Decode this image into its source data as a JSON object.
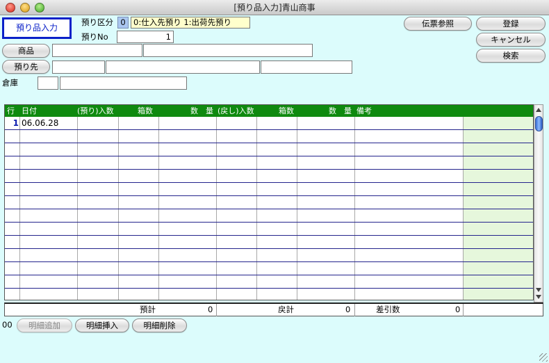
{
  "window": {
    "title": "[預り品入力]青山商事"
  },
  "mode_label": "預り品入力",
  "form": {
    "kubun_label": "預り区分",
    "kubun_code": "0",
    "kubun_desc": "0:仕入先預り 1:出荷先預り",
    "no_label": "預りNo",
    "no_value": "1",
    "product_button": "商品",
    "customer_button": "預り先",
    "warehouse_label": "倉庫"
  },
  "buttons": {
    "slip_ref": "伝票参照",
    "register": "登録",
    "cancel": "キャンセル",
    "search": "検索"
  },
  "table": {
    "headers": [
      "行",
      "日付",
      "(預り)入数",
      "箱数",
      "数　量",
      "(戻し)入数",
      "箱数",
      "数　量",
      "備考"
    ],
    "rows": [
      {
        "num": "1",
        "date": "06.06.28"
      },
      {
        "num": "",
        "date": ""
      },
      {
        "num": "",
        "date": ""
      },
      {
        "num": "",
        "date": ""
      },
      {
        "num": "",
        "date": ""
      },
      {
        "num": "",
        "date": ""
      },
      {
        "num": "",
        "date": ""
      },
      {
        "num": "",
        "date": ""
      },
      {
        "num": "",
        "date": ""
      },
      {
        "num": "",
        "date": ""
      },
      {
        "num": "",
        "date": ""
      },
      {
        "num": "",
        "date": ""
      },
      {
        "num": "",
        "date": ""
      }
    ]
  },
  "totals": {
    "deposit_label": "預計",
    "deposit_value": "0",
    "return_label": "戻計",
    "return_value": "0",
    "diff_label": "差引数",
    "diff_value": "0"
  },
  "footer": {
    "counter": "00",
    "add_line": "明細追加",
    "insert_line": "明細挿入",
    "delete_line": "明細削除"
  }
}
